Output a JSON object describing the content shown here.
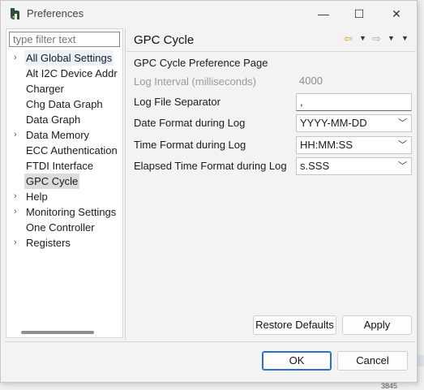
{
  "window": {
    "title": "Preferences",
    "minimize": "—",
    "maximize": "☐",
    "close": "✕"
  },
  "filter": {
    "placeholder": "type filter text"
  },
  "tree": [
    {
      "label": "All Global Settings",
      "twisty": "›",
      "state": "hl"
    },
    {
      "label": "Alt I2C Device Addr",
      "twisty": ""
    },
    {
      "label": "Charger",
      "twisty": ""
    },
    {
      "label": "Chg Data Graph",
      "twisty": ""
    },
    {
      "label": "Data Graph",
      "twisty": ""
    },
    {
      "label": "Data Memory",
      "twisty": "›"
    },
    {
      "label": "ECC Authentication",
      "twisty": ""
    },
    {
      "label": "FTDI Interface",
      "twisty": ""
    },
    {
      "label": "GPC Cycle",
      "twisty": "",
      "state": "sel"
    },
    {
      "label": "Help",
      "twisty": "›"
    },
    {
      "label": "Monitoring Settings",
      "twisty": "›"
    },
    {
      "label": "One Controller",
      "twisty": ""
    },
    {
      "label": "Registers",
      "twisty": "›"
    }
  ],
  "page": {
    "title": "GPC Cycle",
    "description": "GPC Cycle Preference Page",
    "fields": [
      {
        "label": "Log Interval (milliseconds)",
        "value": "4000",
        "kind": "disabled"
      },
      {
        "label": "Log File Separator",
        "value": ",",
        "kind": "text"
      },
      {
        "label": "Date Format during Log",
        "value": "YYYY-MM-DD",
        "kind": "combo"
      },
      {
        "label": "Time Format during Log",
        "value": "HH:MM:SS",
        "kind": "combo"
      },
      {
        "label": "Elapsed Time Format during Log",
        "value": "s.SSS",
        "kind": "combo"
      }
    ]
  },
  "nav": {
    "back_icon": "⇦",
    "forward_icon": "⇨",
    "menu_icon": "▼"
  },
  "buttons": {
    "restore": "Restore Defaults",
    "apply": "Apply",
    "ok": "OK",
    "cancel": "Cancel"
  },
  "background": {
    "number": "3845"
  },
  "colors": {
    "accent": "#2a70c9",
    "nav_back": "#d9a21a"
  }
}
